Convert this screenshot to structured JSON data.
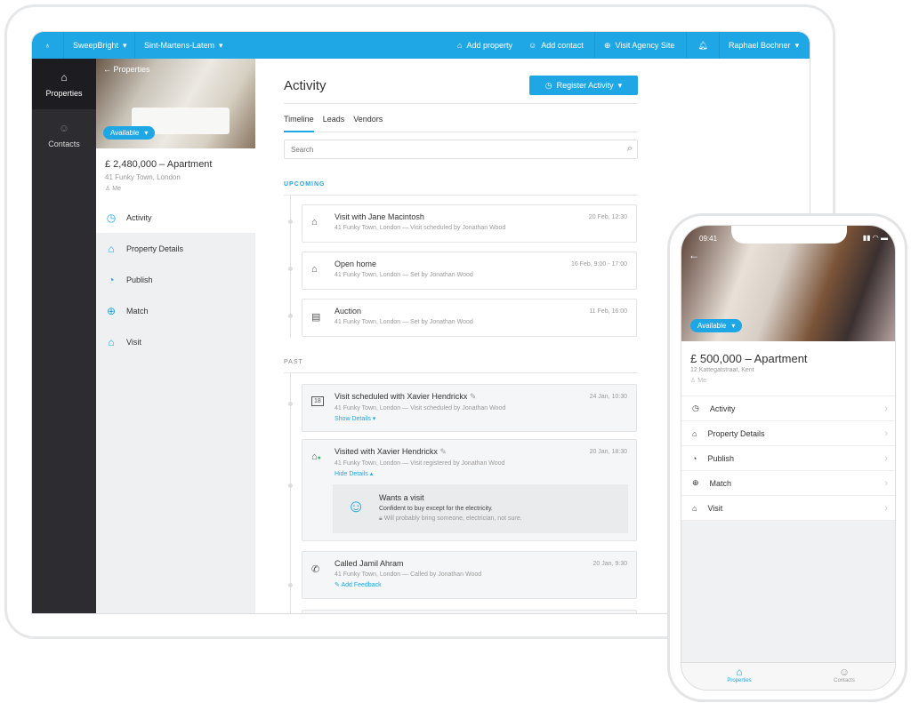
{
  "colors": {
    "accent": "#1ea7e4",
    "sidebar": "#2c2c31"
  },
  "topbar": {
    "company": "SweepBright",
    "office": "Sint-Martens-Latem",
    "add_property": "Add property",
    "add_contact": "Add contact",
    "visit_site": "Visit Agency Site",
    "user": "Raphael Bochner"
  },
  "sidebar": {
    "properties": "Properties",
    "contacts": "Contacts"
  },
  "property": {
    "back": "Properties",
    "status": "Available",
    "title": "£ 2,480,000 – Apartment",
    "address": "41 Funky Town, London",
    "owner": "Me",
    "menu": [
      {
        "label": "Activity",
        "icon": "clock-icon"
      },
      {
        "label": "Property Details",
        "icon": "building-icon"
      },
      {
        "label": "Publish",
        "icon": "broadcast-icon"
      },
      {
        "label": "Match",
        "icon": "target-icon"
      },
      {
        "label": "Visit",
        "icon": "visit-icon"
      }
    ]
  },
  "activity": {
    "title": "Activity",
    "register": "Register Activity",
    "tabs": [
      "Timeline",
      "Leads",
      "Vendors"
    ],
    "search_placeholder": "Search",
    "upcoming_label": "UPCOMING",
    "past_label": "PAST",
    "upcoming": [
      {
        "title": "Visit with Jane Macintosh",
        "sub": "41 Funky Town, London — Visit scheduled by Jonathan Wood",
        "date": "20 Feb, 12:30"
      },
      {
        "title": "Open home",
        "sub": "41 Funky Town, London — Set by Jonathan Wood",
        "date": "16 Feb, 9:00 - 17:00"
      },
      {
        "title": "Auction",
        "sub": "41 Funky Town, London — Set by Jonathan Wood",
        "date": "11 Feb, 16:00"
      }
    ],
    "past": [
      {
        "title": "Visit scheduled with Xavier Hendrickx",
        "sub": "41 Funky Town, London — Visit scheduled by Jonathan Wood",
        "date": "24 Jan, 10:30",
        "link": "Show Details",
        "cal": "18"
      },
      {
        "title": "Visited with Xavier Hendrickx",
        "sub": "41 Funky Town, London — Visit registered by Jonathan Wood",
        "date": "20 Jan, 18:30",
        "link": "Hide Details",
        "feedback": {
          "title": "Wants a visit",
          "text": "Confident to buy except for the electricity.",
          "private": "Will probably bring someone, electrician, not sure."
        }
      },
      {
        "title": "Called Jamil Ahram",
        "sub": "41 Funky Town, London — Called by Jonathan Wood",
        "date": "20 Jan, 9:30",
        "link": "Add Feedback"
      }
    ]
  },
  "phone": {
    "time": "09:41",
    "status": "Available",
    "title": "£ 500,000 – Apartment",
    "address": "12 Kattegatstraat, Kent",
    "owner": "Me",
    "menu": [
      "Activity",
      "Property Details",
      "Publish",
      "Match",
      "Visit"
    ],
    "tab_properties": "Properties",
    "tab_contacts": "Contacts"
  }
}
